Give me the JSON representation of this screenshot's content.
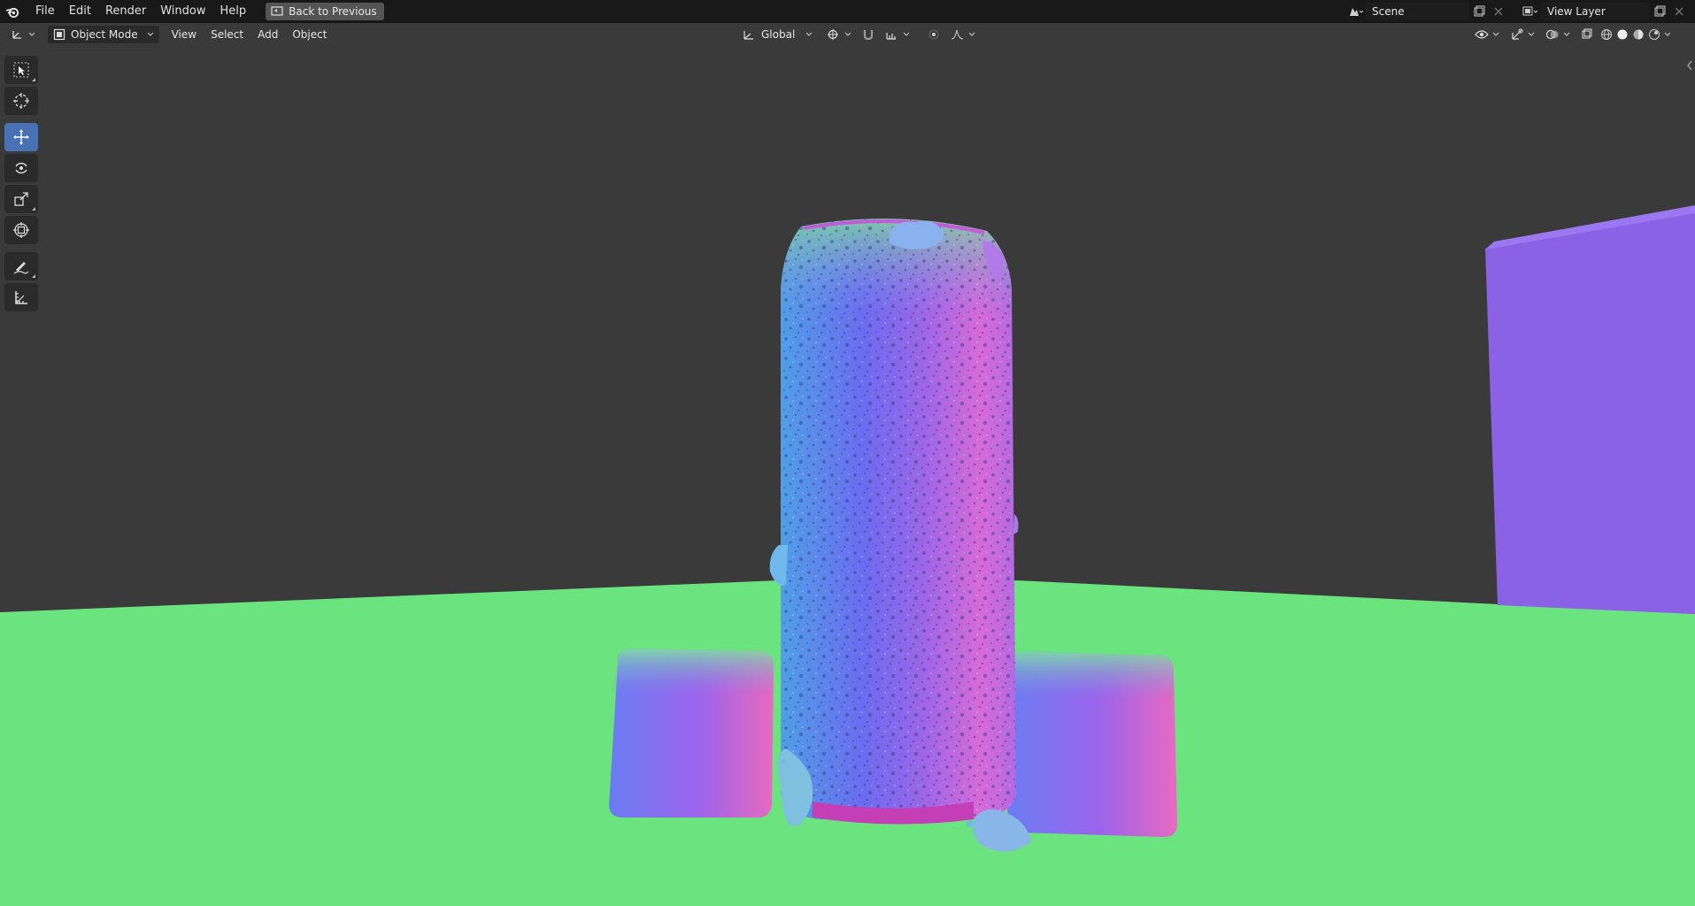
{
  "topbar": {
    "menus": [
      "File",
      "Edit",
      "Render",
      "Window",
      "Help"
    ],
    "back_button": "Back to Previous",
    "scene_name": "Scene",
    "view_layer": "View Layer"
  },
  "viewport_header": {
    "mode": "Object Mode",
    "menus": [
      "View",
      "Select",
      "Add",
      "Object"
    ],
    "transform_orientation": "Global"
  },
  "toolbar": {
    "tools": [
      "select-box",
      "cursor",
      "move",
      "rotate",
      "scale",
      "transform",
      "annotate",
      "measure"
    ],
    "active": "move"
  },
  "colors": {
    "topbar": "#181818",
    "viewport_bg": "#3a3a3a",
    "active_tool": "#4772b3",
    "ground": "#6be37e",
    "wall": "#8a62e6"
  }
}
